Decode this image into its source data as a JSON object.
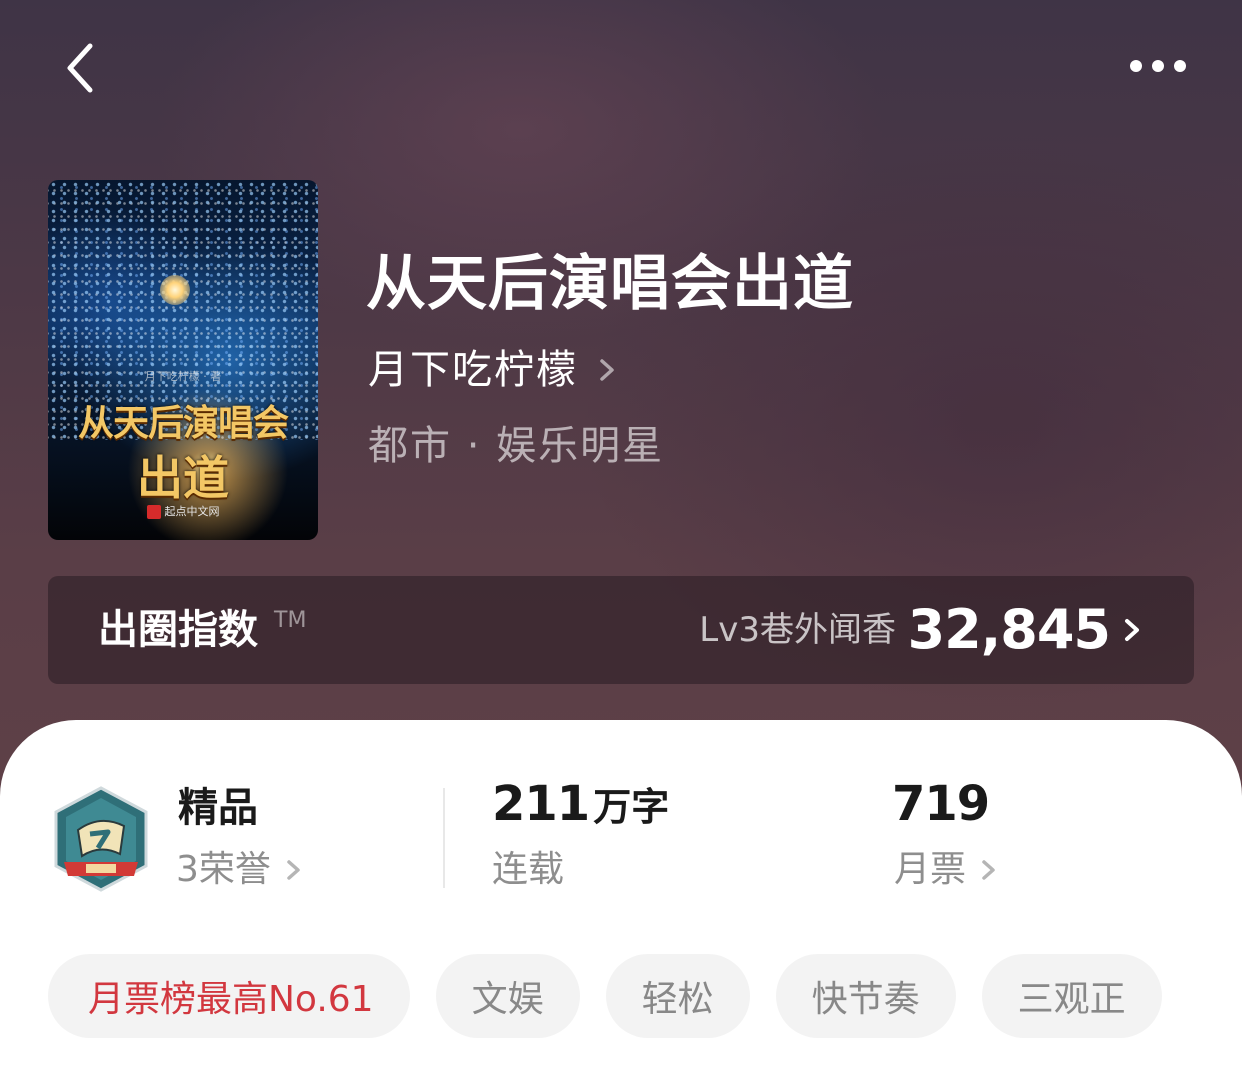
{
  "nav": {
    "back_icon": "chevron-left-icon",
    "more_icon": "more-horizontal-icon"
  },
  "book": {
    "title": "从天后演唱会出道",
    "author": "月下吃柠檬",
    "genre": "都市 · 娱乐明星",
    "cover": {
      "author_text": "月下吃柠檬 · 著",
      "title_line1": "从天后演唱会",
      "title_line2": "出道",
      "publisher": "起点中文网"
    }
  },
  "index": {
    "label": "出圈指数",
    "tm": "TM",
    "level": "Lv3巷外闻香",
    "value": "32,845"
  },
  "stats": {
    "quality": {
      "title": "精品",
      "sub": "3荣誉",
      "badge_icon": "premium-badge-icon"
    },
    "words": {
      "number": "211",
      "unit": "万字",
      "sub": "连载"
    },
    "tickets": {
      "number": "719",
      "sub": "月票"
    }
  },
  "tags": [
    {
      "label": "月票榜最高No.61"
    },
    {
      "label": "文娱"
    },
    {
      "label": "轻松"
    },
    {
      "label": "快节奏"
    },
    {
      "label": "三观正"
    }
  ],
  "colors": {
    "hero_bg": "#4c3846",
    "accent_red": "#d2373f",
    "tag_bg": "#f3f3f3",
    "muted_text": "#8e8e8e"
  }
}
